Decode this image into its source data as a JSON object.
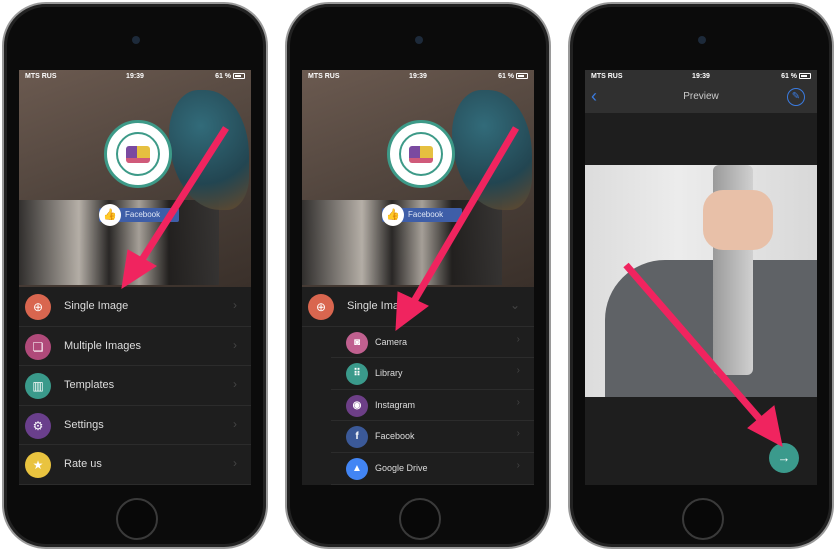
{
  "status": {
    "carrier": "MTS RUS",
    "time": "19:39",
    "battery": "61 %"
  },
  "screen1": {
    "facebook_label": "Facebook",
    "menu": [
      {
        "label": "Single Image",
        "icon": "add-file-icon",
        "color": "#d9664f"
      },
      {
        "label": "Multiple Images",
        "icon": "multiple-images-icon",
        "color": "#b04a7a"
      },
      {
        "label": "Templates",
        "icon": "templates-icon",
        "color": "#3a9a8b"
      },
      {
        "label": "Settings",
        "icon": "gear-icon",
        "color": "#6a3f8c"
      },
      {
        "label": "Rate us",
        "icon": "star-icon",
        "color": "#e9c33f"
      }
    ]
  },
  "screen2": {
    "facebook_label": "Facebook",
    "expanded": {
      "label": "Single Image",
      "color": "#d9664f"
    },
    "sub": [
      {
        "label": "Camera",
        "icon": "camera-icon",
        "color": "#c0608f"
      },
      {
        "label": "Library",
        "icon": "grid-icon",
        "color": "#3a9a8b"
      },
      {
        "label": "Instagram",
        "icon": "instagram-icon",
        "color": "#6d3f87"
      },
      {
        "label": "Facebook",
        "icon": "facebook-icon",
        "color": "#3b5998"
      },
      {
        "label": "Google Drive",
        "icon": "google-drive-icon",
        "color": "#4285f4"
      }
    ]
  },
  "screen3": {
    "title": "Preview"
  },
  "colors": {
    "arrow": "#f0245f",
    "accent": "#3b9a8c",
    "nav_blue": "#3a7be0"
  }
}
